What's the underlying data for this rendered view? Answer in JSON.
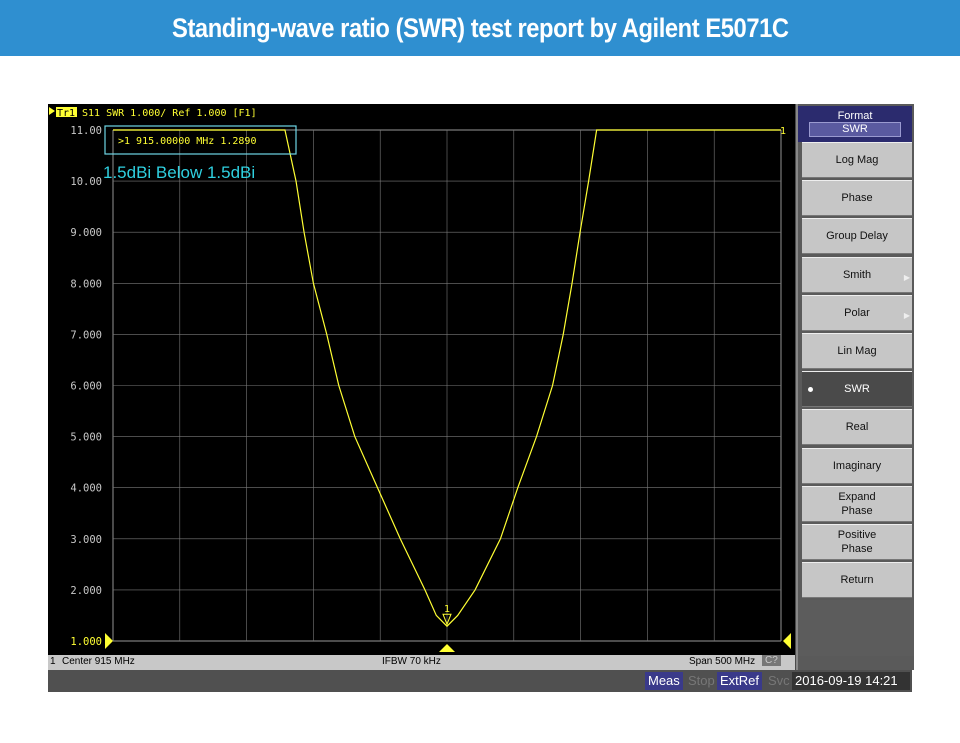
{
  "banner": {
    "title": "Standing-wave ratio (SWR) test report by Agilent E5071C"
  },
  "trace_header": {
    "trace": "Tr1",
    "text": "S11  SWR 1.000/ Ref 1.000 [F1]"
  },
  "marker_readout": {
    "text": ">1  915.00000 MHz  1.2890"
  },
  "annotation": "1.5dBi Below 1.5dBi",
  "status": {
    "channel": "1",
    "center": "Center 915 MHz",
    "ifbw": "IFBW 70 kHz",
    "span": "Span 500 MHz",
    "cal": "C?"
  },
  "bottom": {
    "meas": "Meas",
    "stop": "Stop",
    "extref": "ExtRef",
    "svc": "Svc",
    "datetime": "2016-09-19 14:21"
  },
  "softkeys": {
    "menu_title": "Format",
    "selected": "SWR",
    "items": [
      {
        "label": "Log Mag"
      },
      {
        "label": "Phase"
      },
      {
        "label": "Group Delay"
      },
      {
        "label": "Smith",
        "submenu": true
      },
      {
        "label": "Polar",
        "submenu": true
      },
      {
        "label": "Lin Mag"
      },
      {
        "label": "SWR",
        "active": true
      },
      {
        "label": "Real"
      },
      {
        "label": "Imaginary"
      },
      {
        "label": "Expand\nPhase"
      },
      {
        "label": "Positive\nPhase"
      },
      {
        "label": "Return"
      }
    ]
  },
  "colors": {
    "trace": "#ffff33",
    "grid": "#7a7a7a",
    "marker_box": "#6fd6e6",
    "annotation": "#2fd0e0",
    "banner": "#2f8fd0"
  },
  "chart_data": {
    "type": "line",
    "xlim": [
      665,
      1165
    ],
    "xunit": "MHz",
    "ylim": [
      1,
      11
    ],
    "yticks": [
      "11.00",
      "10.00",
      "9.000",
      "8.000",
      "7.000",
      "6.000",
      "5.000",
      "4.000",
      "3.000",
      "2.000",
      "1.000"
    ],
    "grid": true,
    "series": [
      {
        "x": [
          665,
          793.7,
          802,
          808,
          815,
          825,
          834,
          846,
          863,
          880,
          898.5,
          907,
          915,
          923,
          936,
          955,
          968,
          982,
          994,
          1002,
          1008.6,
          1014.6,
          1021,
          1027,
          1165
        ],
        "y": [
          11,
          11,
          10,
          9,
          8,
          7,
          6,
          5,
          4,
          3,
          2,
          1.5,
          1.289,
          1.5,
          2,
          3,
          4,
          5,
          6,
          7,
          8,
          9,
          10,
          11,
          11
        ]
      }
    ],
    "marker": {
      "label": "1",
      "x": 915,
      "y": 1.289
    },
    "trace_end_label": "1"
  }
}
